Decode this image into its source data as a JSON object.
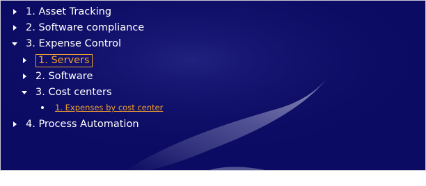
{
  "colors": {
    "panel_bg": "#0b0b63",
    "text": "#ffffff",
    "selected": "#f0a030"
  },
  "tree": {
    "items": [
      {
        "label": "1. Asset Tracking",
        "state": "collapsed"
      },
      {
        "label": "2. Software compliance",
        "state": "collapsed"
      },
      {
        "label": "3. Expense Control",
        "state": "expanded",
        "children": [
          {
            "label": "1. Servers",
            "state": "collapsed",
            "selected": true
          },
          {
            "label": "2. Software",
            "state": "collapsed"
          },
          {
            "label": "3. Cost centers",
            "state": "expanded",
            "children": [
              {
                "label": "1. Expenses by cost center",
                "state": "leaf",
                "link": true
              }
            ]
          }
        ]
      },
      {
        "label": "4. Process Automation",
        "state": "collapsed"
      }
    ]
  },
  "icons": {
    "collapsed": "triangle-right-icon",
    "expanded": "triangle-down-icon",
    "leaf": "bullet-icon"
  }
}
